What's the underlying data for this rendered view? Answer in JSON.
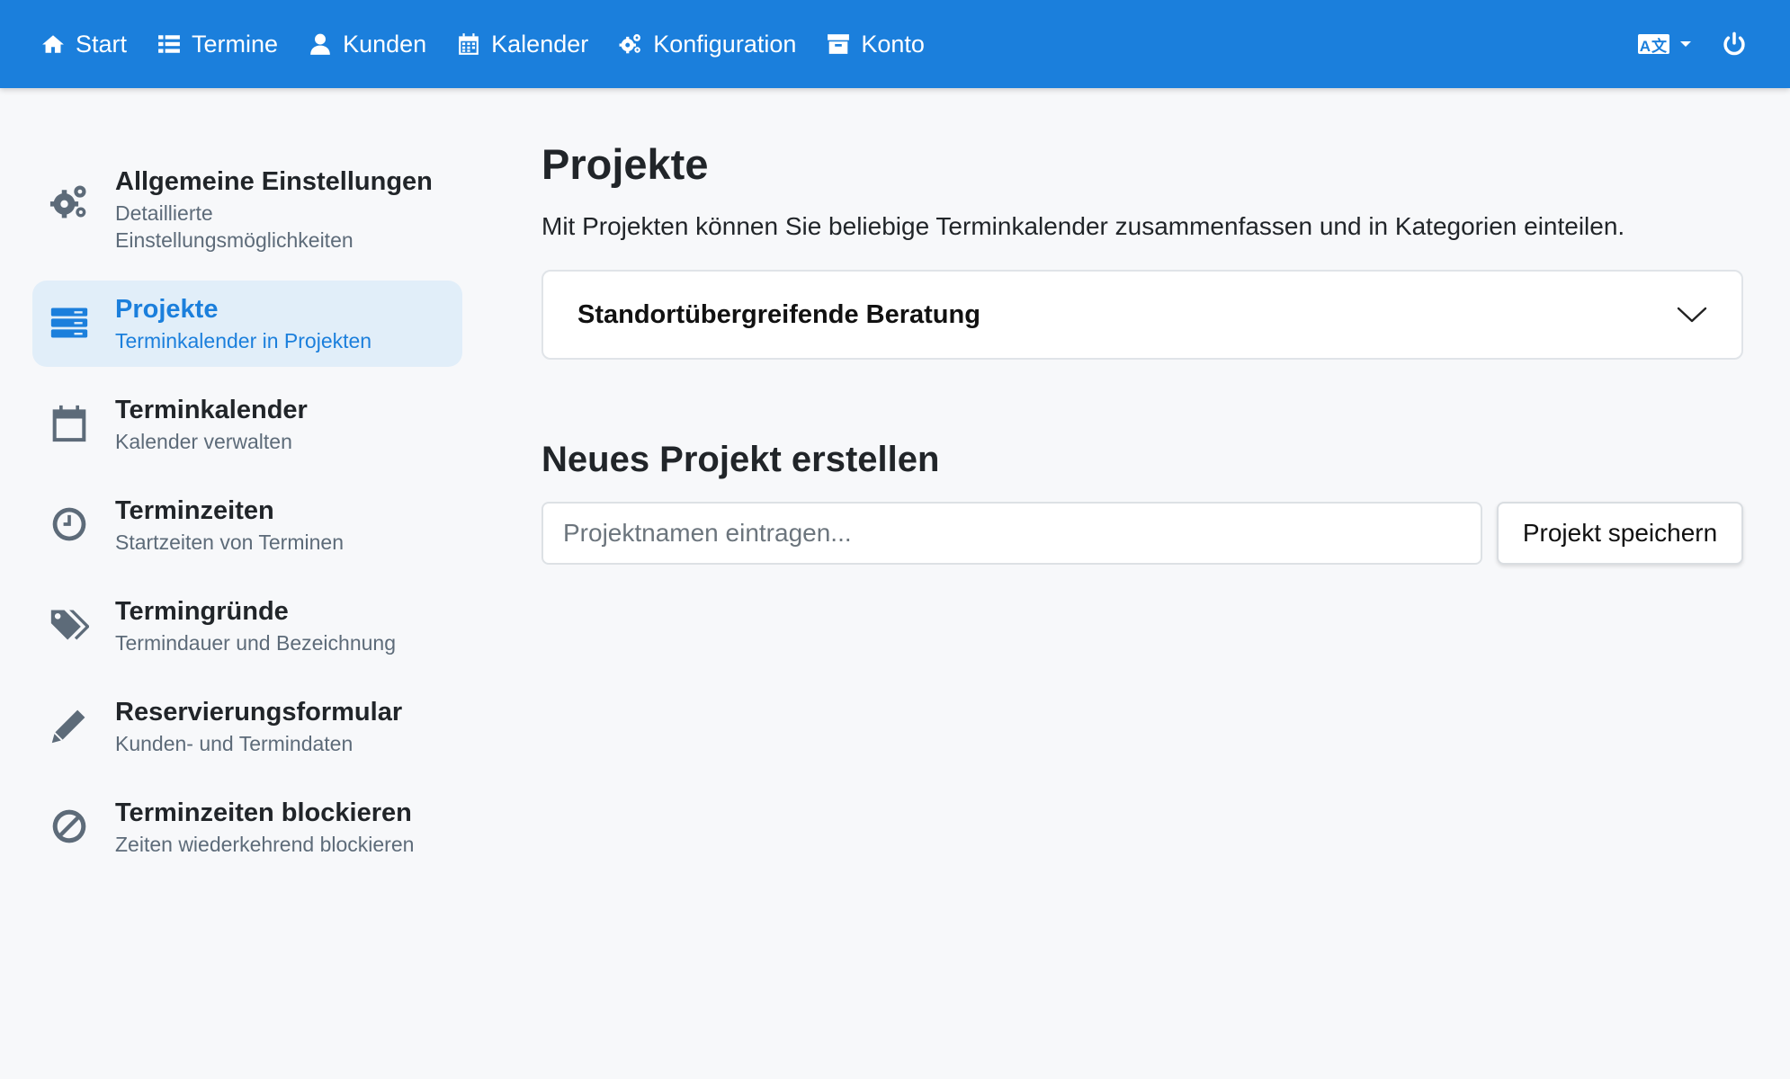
{
  "colors": {
    "primary": "#1b7fdc",
    "background": "#f7f8fa",
    "active_bg": "#e1eef9",
    "muted_text": "#5d6b79"
  },
  "navbar": {
    "items": [
      {
        "label": "Start",
        "icon": "home-icon"
      },
      {
        "label": "Termine",
        "icon": "list-icon"
      },
      {
        "label": "Kunden",
        "icon": "user-icon"
      },
      {
        "label": "Kalender",
        "icon": "calendar-icon"
      },
      {
        "label": "Konfiguration",
        "icon": "cogs-icon"
      },
      {
        "label": "Konto",
        "icon": "archive-icon"
      }
    ],
    "language_icon": "language-icon",
    "language_glyph": "A文",
    "logout_icon": "power-icon"
  },
  "sidebar": {
    "items": [
      {
        "title": "Allgemeine Einstellungen",
        "subtitle": "Detaillierte Einstellungsmöglichkeiten",
        "icon": "cogs-icon",
        "active": false
      },
      {
        "title": "Projekte",
        "subtitle": "Terminkalender in Projekten",
        "icon": "server-icon",
        "active": true
      },
      {
        "title": "Terminkalender",
        "subtitle": "Kalender verwalten",
        "icon": "calendar-icon",
        "active": false
      },
      {
        "title": "Terminzeiten",
        "subtitle": "Startzeiten von Terminen",
        "icon": "clock-icon",
        "active": false
      },
      {
        "title": "Termingründe",
        "subtitle": "Termindauer und Bezeichnung",
        "icon": "tags-icon",
        "active": false
      },
      {
        "title": "Reservierungsformular",
        "subtitle": "Kunden- und Termindaten",
        "icon": "pencil-icon",
        "active": false
      },
      {
        "title": "Terminzeiten blockieren",
        "subtitle": "Zeiten wiederkehrend blockieren",
        "icon": "ban-icon",
        "active": false
      }
    ]
  },
  "main": {
    "title": "Projekte",
    "description": "Mit Projekten können Sie beliebige Terminkalender zusammenfassen und in Kategorien einteilen.",
    "projects": [
      {
        "name": "Standortübergreifende Beratung",
        "expand_icon": "chevron-down-icon"
      }
    ],
    "new_project": {
      "title": "Neues Projekt erstellen",
      "input_value": "",
      "input_placeholder": "Projektnamen eintragen...",
      "save_label": "Projekt speichern"
    }
  }
}
